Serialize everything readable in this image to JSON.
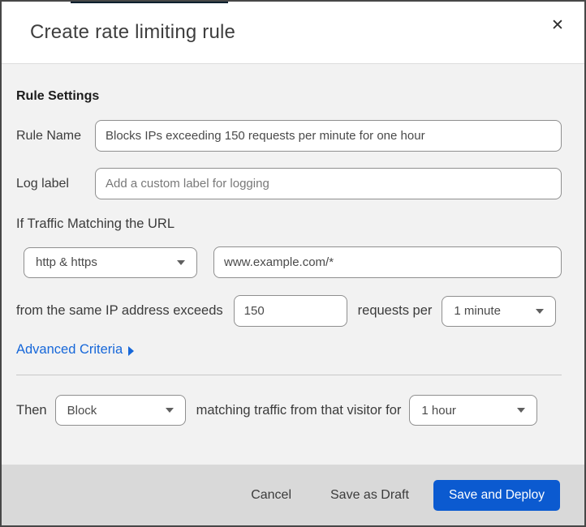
{
  "dialog": {
    "title": "Create rate limiting rule",
    "close_icon": "✕"
  },
  "form": {
    "section_heading": "Rule Settings",
    "rule_name": {
      "label": "Rule Name",
      "value": "Blocks IPs exceeding 150 requests per minute for one hour"
    },
    "log_label": {
      "label": "Log label",
      "placeholder": "Add a custom label for logging"
    },
    "traffic_match": {
      "heading": "If Traffic Matching the URL",
      "scheme_dropdown": {
        "value": "http & https"
      },
      "url_input": {
        "value": "www.example.com/*"
      }
    },
    "threshold": {
      "prefix": "from the same IP address exceeds",
      "requests_value": "150",
      "middle": "requests per",
      "period_dropdown": {
        "value": "1 minute"
      }
    },
    "advanced_criteria": {
      "label": "Advanced Criteria"
    },
    "action": {
      "prefix": "Then",
      "action_dropdown": {
        "value": "Block"
      },
      "middle": "matching traffic from that visitor for",
      "duration_dropdown": {
        "value": "1 hour"
      }
    }
  },
  "footer": {
    "cancel_label": "Cancel",
    "save_draft_label": "Save as Draft",
    "save_deploy_label": "Save and Deploy"
  },
  "colors": {
    "primary_button": "#0b5ad0",
    "link": "#1667d9",
    "body_bg": "#f2f2f2",
    "footer_bg": "#d9d9d9",
    "field_border": "#8f8f8f",
    "top_accent": "#07202f"
  }
}
